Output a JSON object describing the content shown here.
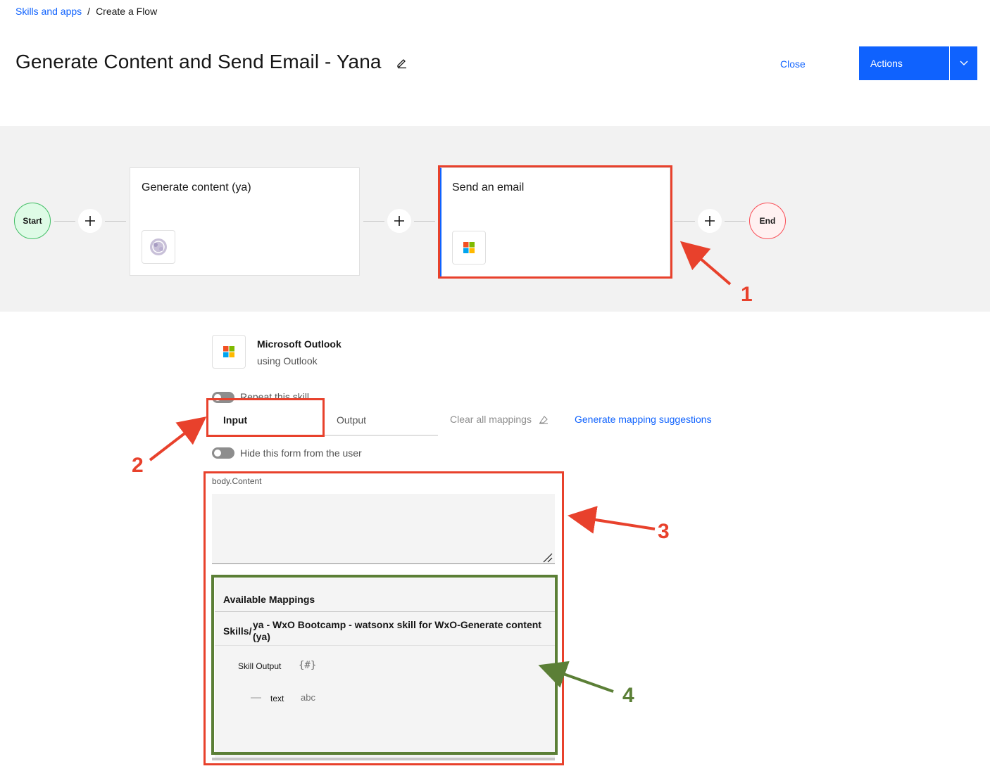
{
  "breadcrumb": {
    "root": "Skills and apps",
    "separator": "/",
    "current": "Create a Flow"
  },
  "header": {
    "title": "Generate Content and Send Email - Yana",
    "close_label": "Close",
    "actions_label": "Actions"
  },
  "flow": {
    "start_label": "Start",
    "end_label": "End",
    "steps": [
      {
        "title": "Generate content (ya)",
        "icon": "watsonx-icon"
      },
      {
        "title": "Send an email",
        "icon": "microsoft-icon"
      }
    ]
  },
  "details": {
    "app_name": "Microsoft Outlook",
    "app_sub": "using Outlook",
    "repeat_label": "Repeat this skill",
    "tabs": {
      "input": "Input",
      "output": "Output"
    },
    "clear_all": "Clear all mappings",
    "generate_suggestions": "Generate mapping suggestions",
    "hide_form_label": "Hide this form from the user",
    "field_label": "body.Content",
    "field_value": "",
    "mappings": {
      "header": "Available Mappings",
      "skills_prefix": "Skills/",
      "skill_name": "ya - WxO Bootcamp - watsonx skill for WxO-Generate content (ya)",
      "skill_output_label": "Skill Output",
      "object_icon": "{#}",
      "text_label": "text",
      "text_type": "abc"
    }
  },
  "annotations": {
    "n1": "1",
    "n2": "2",
    "n3": "3",
    "n4": "4",
    "red": "#e8412c",
    "green": "#5b7f36"
  },
  "colors": {
    "primary": "#0f62fe",
    "canvas": "#f2f2f2"
  }
}
